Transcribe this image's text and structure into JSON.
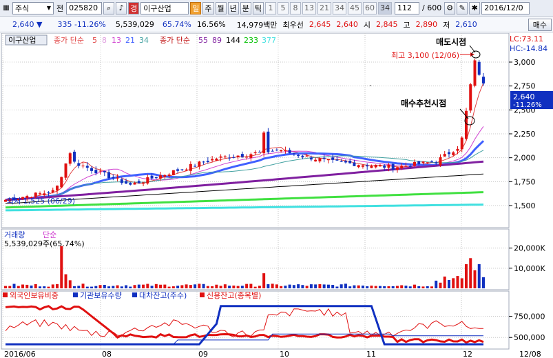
{
  "toolbar": {
    "market_type": "주식",
    "prefix": "전",
    "stock_code": "025820",
    "badge_label": "경",
    "stock_name": "이구산업",
    "period_buttons": [
      "일",
      "주",
      "월",
      "년",
      "분",
      "틱"
    ],
    "period_numbers": [
      "1",
      "5",
      "8",
      "13",
      "21",
      "34",
      "45",
      "60",
      "34"
    ],
    "count": "112",
    "total": "/ 600",
    "date": "2016/12/0"
  },
  "quote": {
    "price": "2,640",
    "direction_symbol": "▼",
    "change": "335 -11.26%",
    "volume": "5,539,029",
    "volume_ratio": "65.74%",
    "turnover": "16.56%",
    "amount": "14,979백만",
    "best_label": "최우선",
    "best_ask": "2,645",
    "best_bid": "2,640",
    "open_label": "시",
    "open": "2,845",
    "high_label": "고",
    "high": "2,890",
    "low_label": "저",
    "low": "2,610",
    "order_button": "매수"
  },
  "price_panel": {
    "legend_stock": "이구산업",
    "legend_ma1_label": "종가 단순",
    "legend_ma1_periods": [
      "5",
      "8",
      "13",
      "21",
      "34"
    ],
    "legend_ma2_label": "종가 단순",
    "legend_ma2_periods": [
      "55",
      "89",
      "144",
      "233",
      "377"
    ],
    "lc_label": "LC:73.11",
    "hc_label": "HC:-14.84",
    "y_ticks": [
      "3,000",
      "2,750",
      "2,500",
      "2,250",
      "2,000",
      "1,750",
      "1,500"
    ],
    "current_price_tag": "2,640",
    "current_change_tag": "-11.26%",
    "high_annotation": "최고 3,100 (12/06)",
    "low_annotation": "최저 1,525 (06/29)",
    "sell_signal": "매도시점",
    "buy_signal": "매수추천시점"
  },
  "volume_panel": {
    "title": "거래량",
    "title_type": "단순",
    "value_text": "5,539,029주(65.74%)",
    "y_ticks": [
      "20,000K",
      "10,000K"
    ]
  },
  "indicator_panel": {
    "labels": [
      "외국인보유비중",
      "기관보유수량",
      "대차잔고(주수)",
      "신용잔고(종목별)"
    ],
    "y_ticks": [
      "750,000",
      "500,000"
    ]
  },
  "x_axis": {
    "ticks": [
      "2016/06",
      "08",
      "09",
      "10",
      "11",
      "12",
      "12/08"
    ]
  },
  "colors": {
    "up": "#e01010",
    "down": "#1030c0",
    "ma5": "#e04040",
    "ma8": "#e0a0e0",
    "ma13": "#d040d0",
    "ma21": "#4060ff",
    "ma34": "#40a0a0",
    "ma55": "#8020a0",
    "ma89": "#000000",
    "ma144": "#00c000",
    "ma233": "#40e040",
    "ma377": "#40e0e0"
  }
}
